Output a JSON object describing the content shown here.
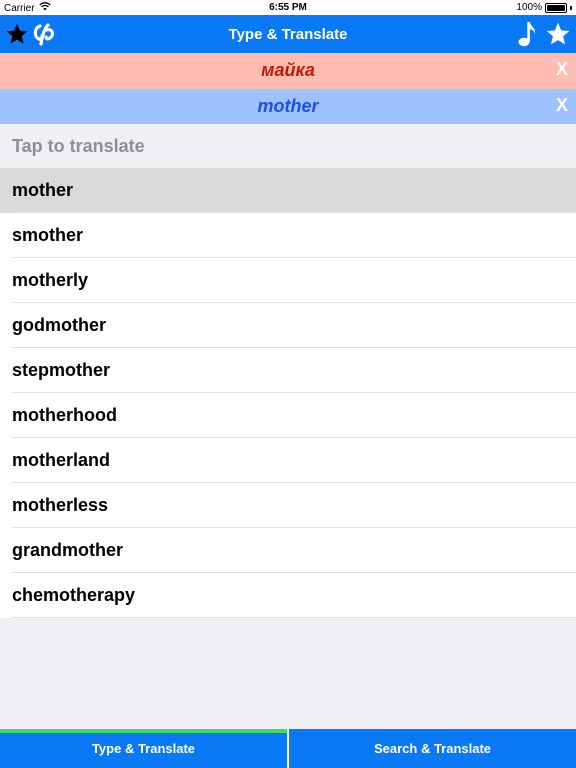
{
  "status_bar": {
    "carrier": "Carrier",
    "time": "6:55 PM",
    "battery": "100%",
    "battery_level": 1.0
  },
  "nav_bar": {
    "title": "Type & Translate",
    "left_icons": [
      "star-icon",
      "app-logo-icon"
    ],
    "right_icons": [
      "music-note-icon",
      "star-icon"
    ]
  },
  "source": {
    "text": "майка",
    "clear_label": "X",
    "bg_color": "#ffbcb0",
    "text_color": "#c0180c"
  },
  "target": {
    "text": "mother",
    "clear_label": "X",
    "bg_color": "#9fc2ff",
    "text_color": "#1b4ff0"
  },
  "prompt": "Tap to translate",
  "suggestions": [
    "mother",
    "smother",
    "motherly",
    "godmother",
    "stepmother",
    "motherhood",
    "motherland",
    "motherless",
    "grandmother",
    "chemotherapy"
  ],
  "selected_index": 0,
  "tabs": {
    "left": "Type & Translate",
    "right": "Search & Translate",
    "active": "left"
  },
  "colors": {
    "accent": "#0a79f5",
    "active_tab_indicator": "#43d86a"
  }
}
